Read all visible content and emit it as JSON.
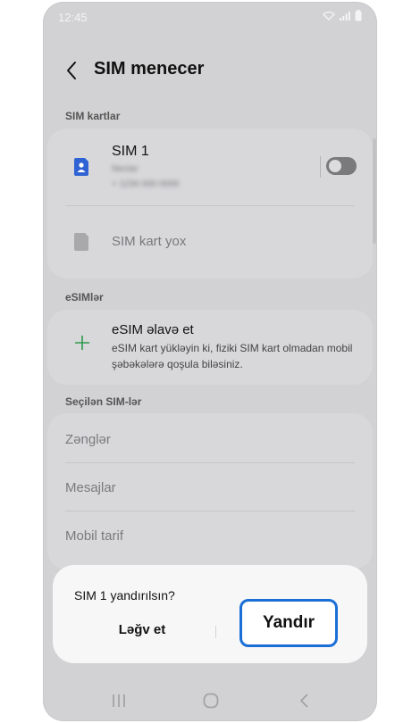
{
  "status": {
    "time": "12:45"
  },
  "header": {
    "title": "SIM menecer"
  },
  "sections": {
    "sim_cards": "SIM kartlar",
    "esims": "eSIMlər",
    "preferred": "Seçilən SIM-lər"
  },
  "sim_cards": [
    {
      "title": "SIM 1",
      "carrier": "Nectar",
      "number": "+ 1234 000 0000",
      "enabled": false
    },
    {
      "title": "SIM kart yox"
    }
  ],
  "esim": {
    "title": "eSIM əlavə et",
    "description": "eSIM kart yükləyin ki, fiziki SIM kart olmadan mobil şəbəkələrə qoşula biləsiniz."
  },
  "preferred_items": [
    "Zənglər",
    "Mesajlar",
    "Mobil tarif"
  ],
  "dialog": {
    "title": "SIM 1 yandırılsın?",
    "cancel_label": "Ləğv et",
    "confirm_label": "Yandır"
  },
  "colors": {
    "accent": "#1a6fd6",
    "sim_icon": "#2f63d4",
    "plus_icon": "#2e9a4b",
    "screen_dim": "#d2d2d4"
  },
  "icons": {
    "back": "chevron-left-icon",
    "sim": "sim-card-icon",
    "add": "plus-icon",
    "nav": [
      "recent-apps-icon",
      "home-icon",
      "back-icon"
    ]
  }
}
